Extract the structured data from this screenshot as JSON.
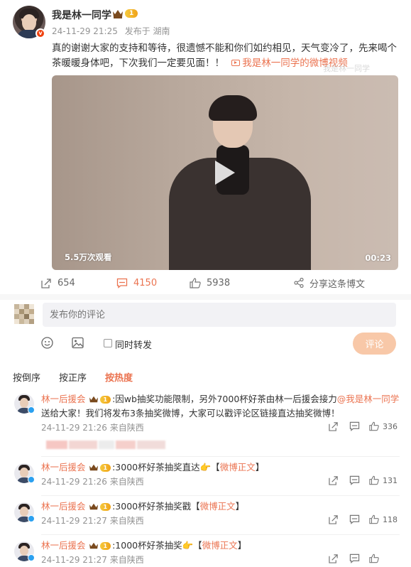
{
  "post": {
    "username": "我是林一同学",
    "level": "1",
    "time": "24-11-29 21:25",
    "source": "发布于 湖南",
    "text": "真的谢谢大家的支持和等待，很遗憾不能和你们如约相见，天气变冷了，先来喝个茶暖暖身体吧，下次我们一定要见面！！",
    "video_link": "我是林一同学的微博视频",
    "watermark": "我是林一同学",
    "video": {
      "views": "5.5万次观看",
      "duration": "00:23"
    },
    "actions": {
      "share_count": "654",
      "comment_count": "4150",
      "like_count": "5938",
      "share_label": "分享这条博文"
    }
  },
  "composer": {
    "placeholder": "发布你的评论",
    "repost_label": "同时转发",
    "submit_label": "评论"
  },
  "sort_tabs": [
    "按倒序",
    "按正序",
    "按热度"
  ],
  "comments": [
    {
      "name": "林一后援会",
      "level": "1",
      "text_before": ":因wb抽奖功能限制，另外7000杯好茶由林一后援会接力",
      "mention": "@我是林一同学",
      "text_after": " 送给大家！我们将发布3条抽奖微博，大家可以戳评论区链接直达抽奖微博！",
      "time": "24-11-29 21:26",
      "from": "来自陕西",
      "likes": "336"
    },
    {
      "name": "林一后援会",
      "level": "1",
      "text": ":3000杯好茶抽奖直达👉【",
      "link": "微博正文",
      "text_end": "】",
      "time": "24-11-29 21:26",
      "from": "来自陕西",
      "likes": "131"
    },
    {
      "name": "林一后援会",
      "level": "1",
      "text": ":3000杯好茶抽奖戳【",
      "link": "微博正文",
      "text_end": "】",
      "time": "24-11-29 21:27",
      "from": "来自陕西",
      "likes": "118"
    },
    {
      "name": "林一后援会",
      "level": "1",
      "text": ":1000杯好茶抽奖👉【",
      "link": "微博正文",
      "text_end": "】",
      "time": "24-11-29 21:27",
      "from": "来自陕西",
      "likes": ""
    }
  ],
  "colors": {
    "accent": "#eb7350",
    "muted": "#939393",
    "submit_bg": "#f8c8a8"
  },
  "icons": [
    "repost-icon",
    "comment-icon",
    "like-icon",
    "share-icon",
    "emoji-icon",
    "image-icon",
    "play-icon",
    "crown-icon",
    "verified-icon",
    "video-link-icon"
  ]
}
